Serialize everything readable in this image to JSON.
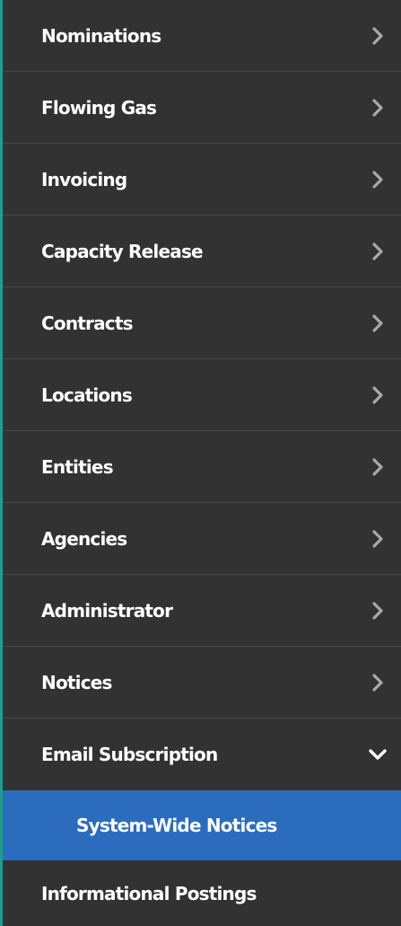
{
  "menu": {
    "items": [
      {
        "label": "Nominations",
        "icon": "chevron-right-icon"
      },
      {
        "label": "Flowing Gas",
        "icon": "chevron-right-icon"
      },
      {
        "label": "Invoicing",
        "icon": "chevron-right-icon"
      },
      {
        "label": "Capacity Release",
        "icon": "chevron-right-icon"
      },
      {
        "label": "Contracts",
        "icon": "chevron-right-icon"
      },
      {
        "label": "Locations",
        "icon": "chevron-right-icon"
      },
      {
        "label": "Entities",
        "icon": "chevron-right-icon"
      },
      {
        "label": "Agencies",
        "icon": "chevron-right-icon"
      },
      {
        "label": "Administrator",
        "icon": "chevron-right-icon"
      },
      {
        "label": "Notices",
        "icon": "chevron-right-icon"
      },
      {
        "label": "Email Subscription",
        "icon": "chevron-down-icon",
        "expanded": true
      }
    ],
    "email_subscription_children": [
      {
        "label": "System-Wide Notices",
        "selected": true
      }
    ],
    "after_items": [
      {
        "label": "Informational Postings"
      }
    ]
  },
  "colors": {
    "background": "#323232",
    "divider": "#474747",
    "selected": "#2b6cbf",
    "accent_border": "#1f9c8f",
    "chevron_right": "#a9a9a9",
    "chevron_down": "#ffffff"
  }
}
